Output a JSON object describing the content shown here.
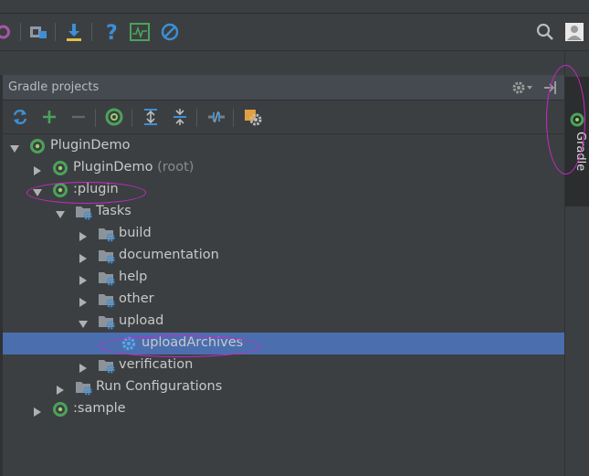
{
  "colors": {
    "accent": "#4b6eaf",
    "gradle": "#4aa35a",
    "annotation": "#c928c9"
  },
  "toolbar": {
    "icons": [
      "sync-back-icon",
      "project-structure-icon",
      "download-sdk-icon",
      "help-icon",
      "activity-monitor-icon",
      "no-entry-icon",
      "search-icon",
      "user-avatar-icon"
    ]
  },
  "panel": {
    "title": "Gradle projects"
  },
  "tree": [
    {
      "label": "PluginDemo",
      "level": 0,
      "expanded": true,
      "icon": "gradle-project-icon"
    },
    {
      "label": "PluginDemo",
      "suffix": "(root)",
      "level": 1,
      "expanded": false,
      "icon": "gradle-project-icon"
    },
    {
      "label": ":plugin",
      "level": 1,
      "expanded": true,
      "icon": "gradle-project-icon"
    },
    {
      "label": "Tasks",
      "level": 2,
      "expanded": true,
      "icon": "tasks-folder-icon"
    },
    {
      "label": "build",
      "level": 3,
      "expanded": false,
      "icon": "tasks-folder-icon"
    },
    {
      "label": "documentation",
      "level": 3,
      "expanded": false,
      "icon": "tasks-folder-icon"
    },
    {
      "label": "help",
      "level": 3,
      "expanded": false,
      "icon": "tasks-folder-icon"
    },
    {
      "label": "other",
      "level": 3,
      "expanded": false,
      "icon": "tasks-folder-icon"
    },
    {
      "label": "upload",
      "level": 3,
      "expanded": true,
      "icon": "tasks-folder-icon"
    },
    {
      "label": "uploadArchives",
      "level": 4,
      "selected": true,
      "icon": "task-gear-icon"
    },
    {
      "label": "verification",
      "level": 3,
      "expanded": false,
      "icon": "tasks-folder-icon"
    },
    {
      "label": "Run Configurations",
      "level": 2,
      "expanded": false,
      "icon": "tasks-folder-icon"
    },
    {
      "label": ":sample",
      "level": 1,
      "expanded": false,
      "icon": "gradle-project-icon"
    }
  ],
  "sidebar": {
    "gradle_tab": "Gradle"
  }
}
